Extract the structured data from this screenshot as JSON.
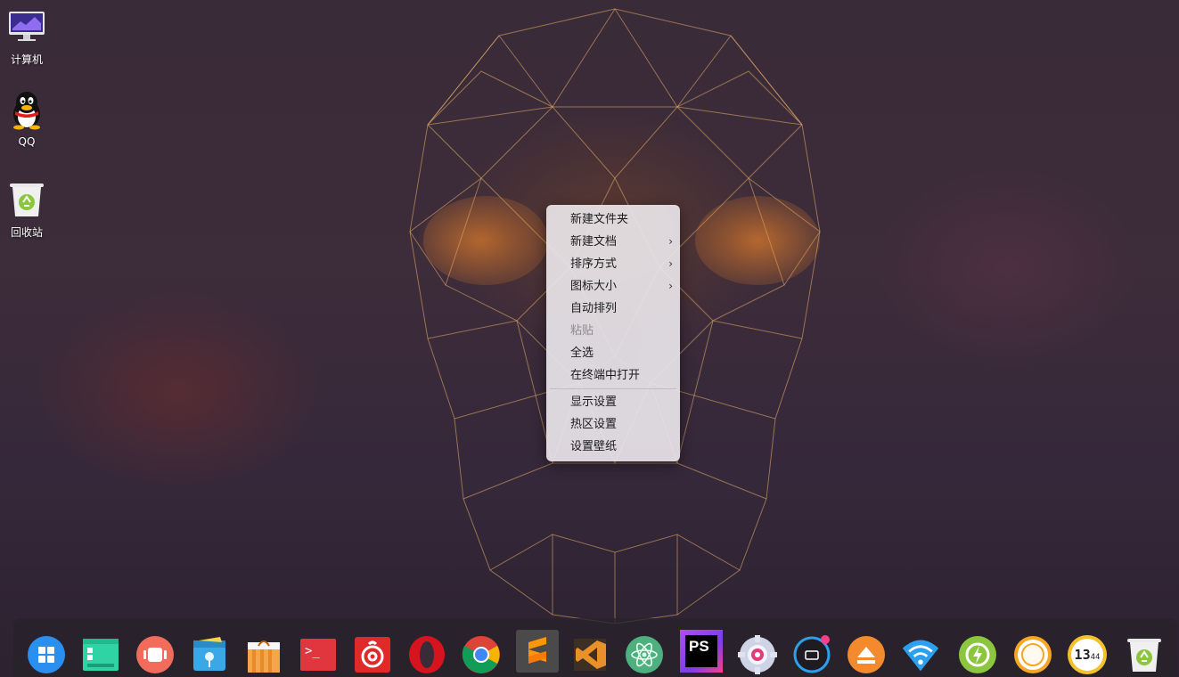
{
  "desktop": {
    "icons": [
      {
        "label": "计算机",
        "icon": "computer-icon"
      },
      {
        "label": "QQ",
        "icon": "qq-penguin-icon"
      },
      {
        "label": "回收站",
        "icon": "trash-icon"
      }
    ]
  },
  "context_menu": {
    "items": [
      {
        "label": "新建文件夹",
        "submenu": false,
        "enabled": true
      },
      {
        "label": "新建文档",
        "submenu": true,
        "enabled": true
      },
      {
        "label": "排序方式",
        "submenu": true,
        "enabled": true
      },
      {
        "label": "图标大小",
        "submenu": true,
        "enabled": true
      },
      {
        "label": "自动排列",
        "submenu": false,
        "enabled": true
      },
      {
        "label": "粘贴",
        "submenu": false,
        "enabled": false
      },
      {
        "label": "全选",
        "submenu": false,
        "enabled": true
      },
      {
        "label": "在终端中打开",
        "submenu": false,
        "enabled": true
      },
      {
        "label": "显示设置",
        "submenu": false,
        "enabled": true
      },
      {
        "label": "热区设置",
        "submenu": false,
        "enabled": true
      },
      {
        "label": "设置壁纸",
        "submenu": false,
        "enabled": true
      }
    ],
    "submenu_arrow": "›"
  },
  "dock": {
    "items": [
      {
        "icon": "launcher-icon"
      },
      {
        "icon": "file-manager-icon"
      },
      {
        "icon": "multitask-view-icon"
      },
      {
        "icon": "deepin-store-icon"
      },
      {
        "icon": "app-store-bag-icon"
      },
      {
        "icon": "terminal-icon",
        "text": ">_"
      },
      {
        "icon": "netease-music-icon"
      },
      {
        "icon": "opera-browser-icon"
      },
      {
        "icon": "chrome-browser-icon"
      },
      {
        "icon": "sublime-text-icon"
      },
      {
        "icon": "visual-studio-icon"
      },
      {
        "icon": "atom-editor-icon"
      },
      {
        "icon": "phpstorm-icon",
        "text": "PS"
      },
      {
        "icon": "control-center-icon"
      },
      {
        "icon": "onboard-keyboard-icon"
      },
      {
        "icon": "eject-icon"
      },
      {
        "icon": "wifi-icon"
      },
      {
        "icon": "power-icon"
      },
      {
        "icon": "shutdown-icon"
      },
      {
        "icon": "clock-icon",
        "text_hour": "13",
        "text_min": "44"
      },
      {
        "icon": "trash-icon"
      }
    ]
  },
  "colors": {
    "accent_blue": "#2aa0ee",
    "menu_bg": "#e8e4e8",
    "dock_bg": "#28222a"
  }
}
